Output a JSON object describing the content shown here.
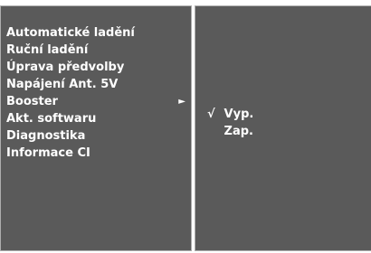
{
  "menu": {
    "items": [
      {
        "label": "Automatické ladění"
      },
      {
        "label": "Ruční ladění"
      },
      {
        "label": "Úprava předvolby"
      },
      {
        "label": "Napájení Ant. 5V"
      },
      {
        "label": "Booster",
        "has_submenu": true,
        "arrow": "►"
      },
      {
        "label": "Akt. softwaru"
      },
      {
        "label": "Diagnostika"
      },
      {
        "label": "Informace CI"
      }
    ]
  },
  "submenu": {
    "options": [
      {
        "label": "Vyp.",
        "check": "√"
      },
      {
        "label": "Zap.",
        "check": ""
      }
    ]
  },
  "colors": {
    "panel_bg": "#5a5a5a",
    "panel_border": "#aeaeae",
    "text": "#ffffff"
  }
}
